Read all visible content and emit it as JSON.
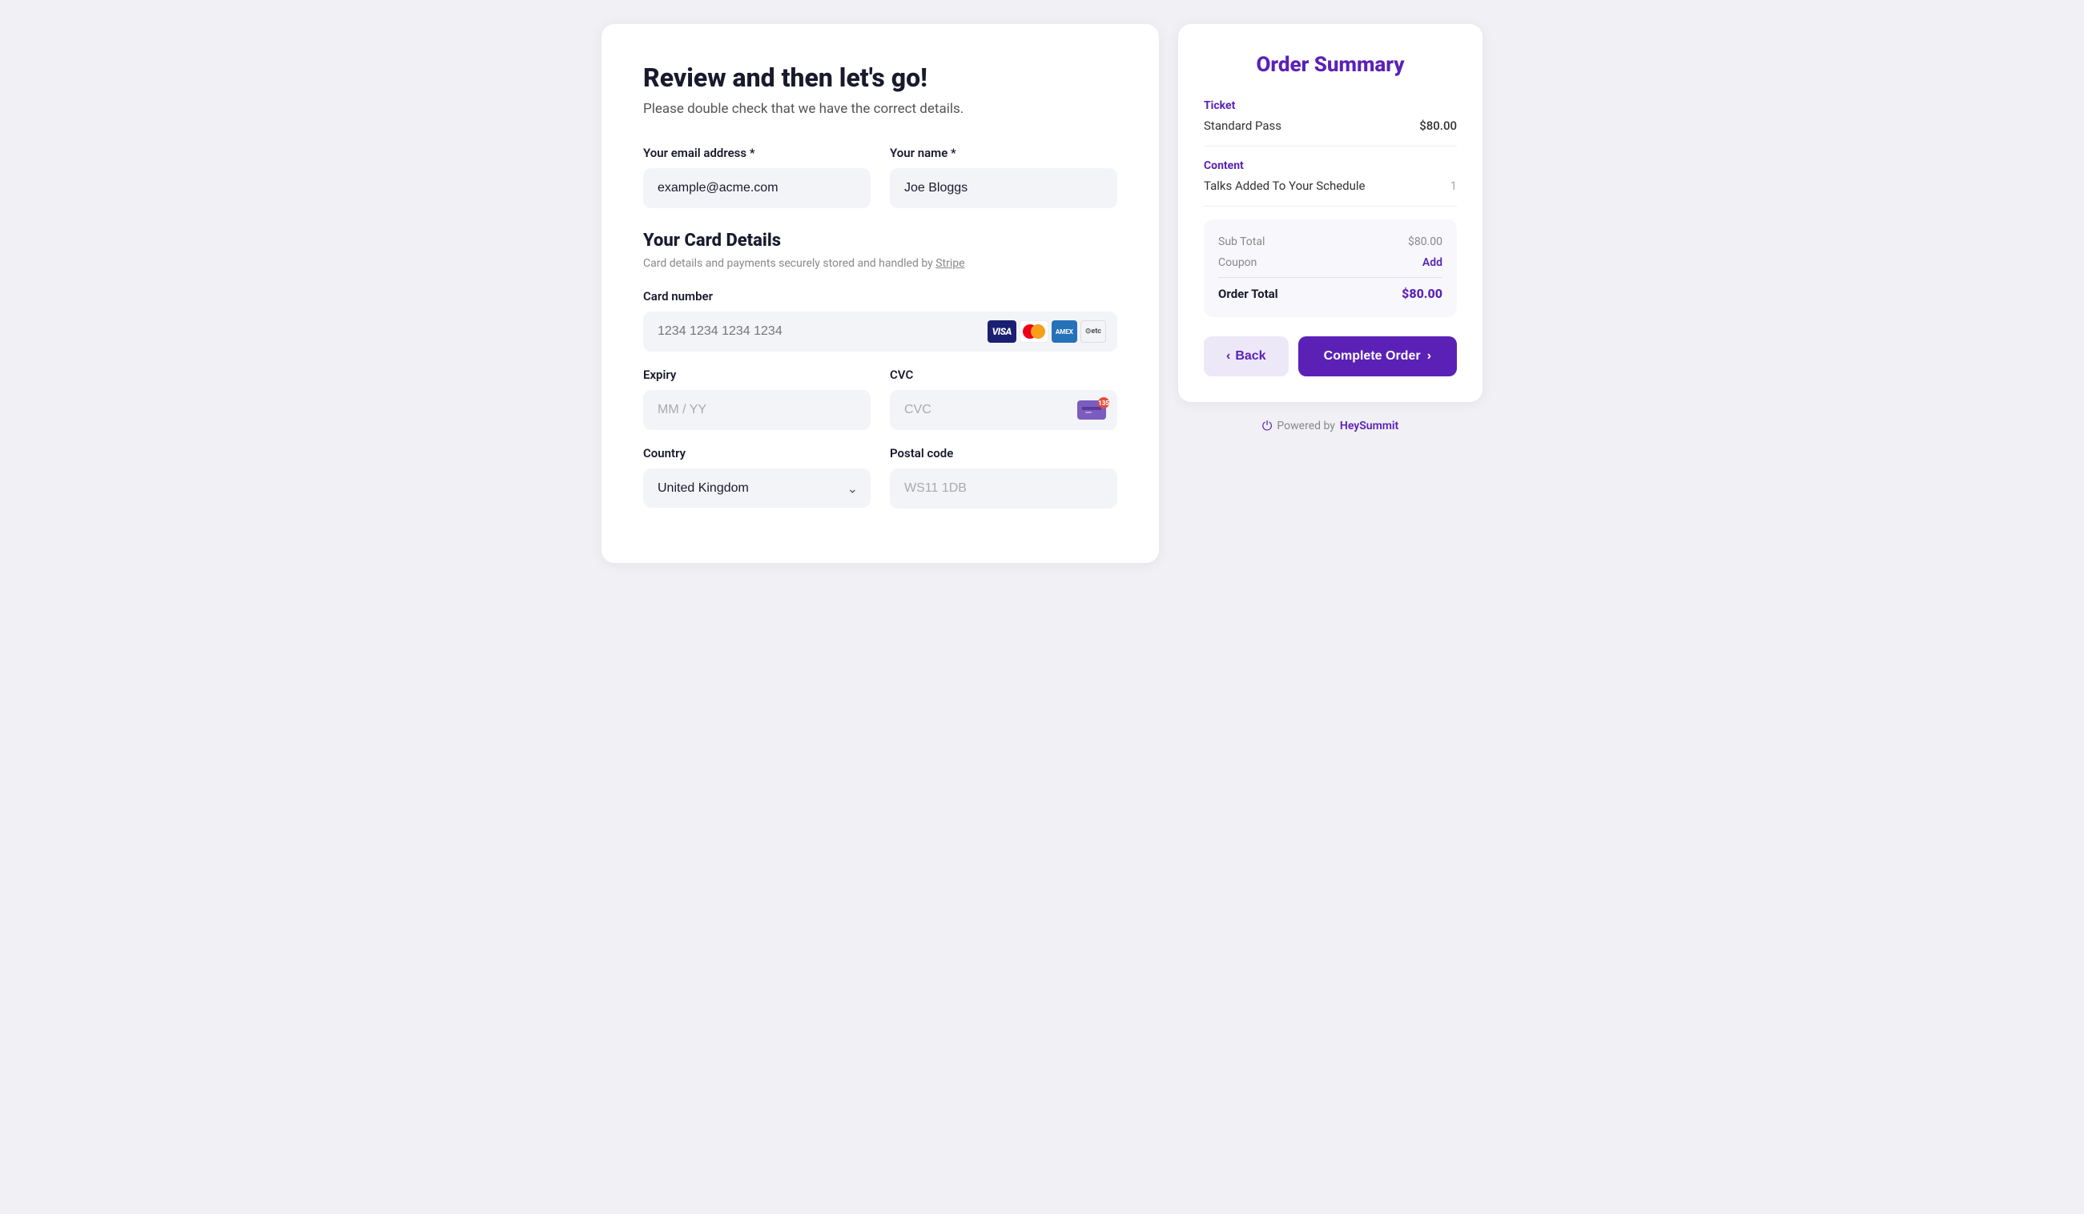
{
  "page": {
    "title": "Review and then let's go!",
    "subtitle": "Please double check that we have the correct details."
  },
  "form": {
    "email_label": "Your email address *",
    "email_value": "example@acme.com",
    "name_label": "Your name *",
    "name_value": "Joe Bloggs",
    "card_section_title": "Your Card Details",
    "card_section_subtitle": "Card details and payments securely stored and handled by",
    "stripe_link_text": "Stripe",
    "card_number_label": "Card number",
    "card_number_placeholder": "1234 1234 1234 1234",
    "expiry_label": "Expiry",
    "expiry_placeholder": "MM / YY",
    "cvc_label": "CVC",
    "cvc_placeholder": "CVC",
    "country_label": "Country",
    "country_value": "United Kingdom",
    "postal_label": "Postal code",
    "postal_placeholder": "WS11 1DB"
  },
  "order_summary": {
    "title": "Order Summary",
    "ticket_label": "Ticket",
    "ticket_name": "Standard Pass",
    "ticket_price": "$80.00",
    "content_label": "Content",
    "content_name": "Talks Added To Your Schedule",
    "content_count": "1",
    "subtotal_label": "Sub Total",
    "subtotal_amount": "$80.00",
    "coupon_label": "Coupon",
    "coupon_action": "Add",
    "order_total_label": "Order Total",
    "order_total_amount": "$80.00",
    "back_label": "Back",
    "complete_label": "Complete Order",
    "powered_by_text": "Powered by",
    "brand_name": "HeySummit"
  }
}
